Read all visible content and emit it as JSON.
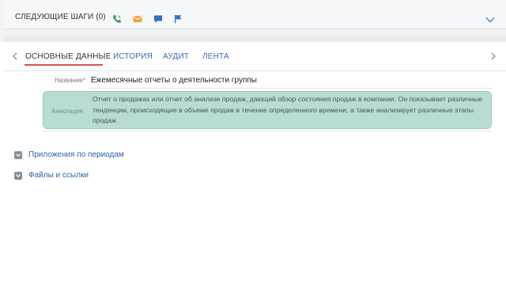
{
  "next_steps": {
    "title": "СЛЕДУЮЩИЕ ШАГИ (0)",
    "icons": [
      "phone-icon",
      "email-icon",
      "chat-icon",
      "flag-icon"
    ],
    "icon_colors": {
      "phone": "#2e9e5b",
      "email": "#f0a23a",
      "chat": "#2b72c4",
      "flag": "#2b72c4"
    }
  },
  "tabs": [
    {
      "label": "ОСНОВНЫЕ ДАННЫЕ",
      "active": true
    },
    {
      "label": "ИСТОРИЯ",
      "active": false
    },
    {
      "label": "АУДИТ",
      "active": false
    },
    {
      "label": "ЛЕНТА",
      "active": false
    }
  ],
  "form": {
    "name_label": "Название",
    "name_required": "*",
    "name_value": "Ежемесячные отчеты о деятельности группы",
    "annotation_label": "Аннотация",
    "annotation_value": "Отчет о продажах или отчет об анализе продаж, дающий обзор состояния продаж в компании. Он показывает различные тенденции, происходящие в объеме продаж в течение определенного времени, а также анализирует различные этапы продаж"
  },
  "sections": [
    {
      "label": "Приложения по периодам"
    },
    {
      "label": "Файлы и ссылки"
    }
  ],
  "colors": {
    "accent_red": "#d9534f",
    "link_blue": "#2f62a3",
    "annotation_bg": "#b8dbd3"
  }
}
